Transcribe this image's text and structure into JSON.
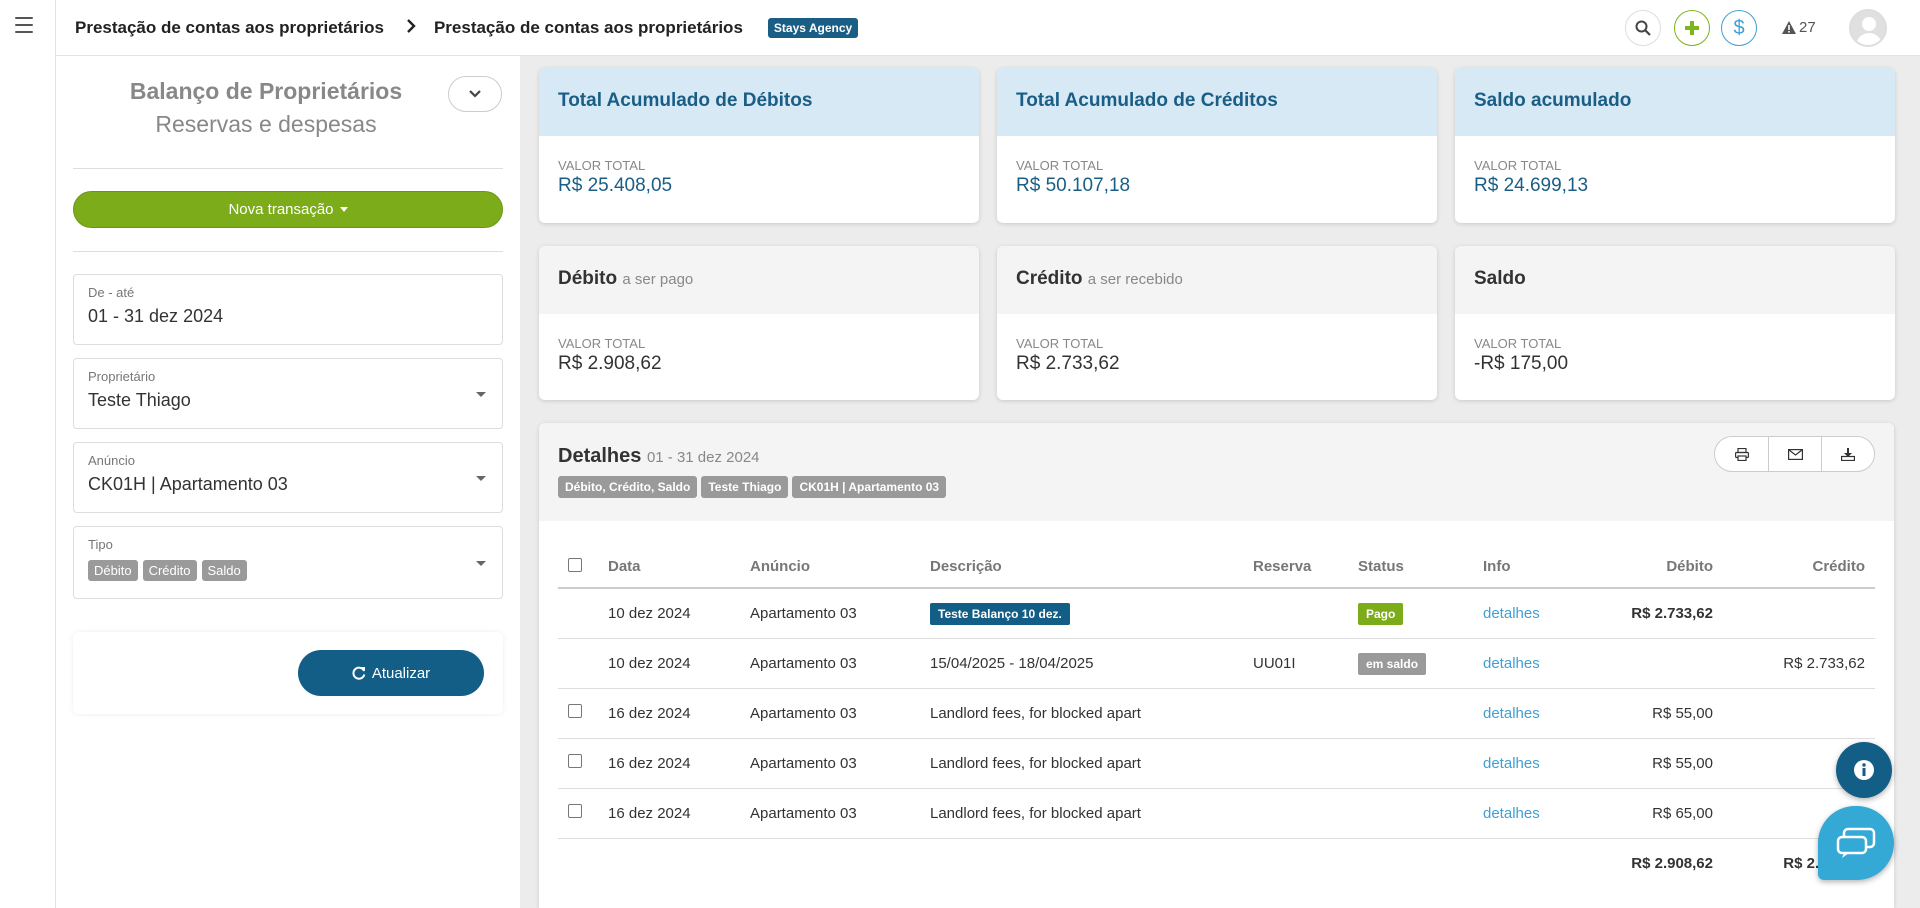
{
  "topbar": {
    "breadcrumb_1": "Prestação de contas aos proprietários",
    "breadcrumb_2": "Prestação de contas aos proprietários",
    "agency_badge": "Stays Agency",
    "alert_count": "27"
  },
  "sidebar": {
    "title": "Balanço de Proprietários",
    "subtitle": "Reservas e despesas",
    "new_transaction_label": "Nova transação",
    "date_range": {
      "label": "De - até",
      "value": "01 - 31 dez 2024"
    },
    "owner": {
      "label": "Proprietário",
      "value": "Teste Thiago"
    },
    "listing": {
      "label": "Anúncio",
      "value": "CK01H | Apartamento 03"
    },
    "type": {
      "label": "Tipo",
      "tags": [
        "Débito",
        "Crédito",
        "Saldo"
      ]
    },
    "refresh_label": "Atualizar"
  },
  "cards": {
    "debits_total": {
      "title": "Total Acumulado de Débitos",
      "label": "VALOR TOTAL",
      "value": "R$ 25.408,05"
    },
    "credits_total": {
      "title": "Total Acumulado de Créditos",
      "label": "VALOR TOTAL",
      "value": "R$ 50.107,18"
    },
    "balance_total": {
      "title": "Saldo acumulado",
      "label": "VALOR TOTAL",
      "value": "R$ 24.699,13"
    },
    "debit": {
      "title": "Débito",
      "subtitle": "a ser pago",
      "label": "VALOR TOTAL",
      "value": "R$ 2.908,62"
    },
    "credit": {
      "title": "Crédito",
      "subtitle": "a ser recebido",
      "label": "VALOR TOTAL",
      "value": "R$ 2.733,62"
    },
    "balance": {
      "title": "Saldo",
      "label": "VALOR TOTAL",
      "value": "-R$ 175,00"
    }
  },
  "details": {
    "title": "Detalhes",
    "range": "01 - 31 dez 2024",
    "filter_tags": [
      "Débito, Crédito, Saldo",
      "Teste Thiago",
      "CK01H | Apartamento 03"
    ],
    "columns": [
      "Data",
      "Anúncio",
      "Descrição",
      "Reserva",
      "Status",
      "Info",
      "Débito",
      "Crédito"
    ],
    "rows": [
      {
        "date": "10 dez 2024",
        "listing": "Apartamento 03",
        "description": "Teste Balanço 10 dez.",
        "reservation": "",
        "status": "Pago",
        "info": "detalhes",
        "debit": "R$ 2.733,62",
        "credit": ""
      },
      {
        "date": "10 dez 2024",
        "listing": "Apartamento 03",
        "description": "15/04/2025 - 18/04/2025",
        "reservation": "UU01I",
        "status": "em saldo",
        "info": "detalhes",
        "debit": "",
        "credit": "R$ 2.733,62"
      },
      {
        "date": "16 dez 2024",
        "listing": "Apartamento 03",
        "description": "Landlord fees, for blocked apart",
        "reservation": "",
        "status": "",
        "info": "detalhes",
        "debit": "R$ 55,00",
        "credit": ""
      },
      {
        "date": "16 dez 2024",
        "listing": "Apartamento 03",
        "description": "Landlord fees, for blocked apart",
        "reservation": "",
        "status": "",
        "info": "detalhes",
        "debit": "R$ 55,00",
        "credit": ""
      },
      {
        "date": "16 dez 2024",
        "listing": "Apartamento 03",
        "description": "Landlord fees, for blocked apart",
        "reservation": "",
        "status": "",
        "info": "detalhes",
        "debit": "R$ 65,00",
        "credit": ""
      }
    ],
    "totals": {
      "debit": "R$ 2.908,62",
      "credit": "R$ 2.733,62"
    }
  },
  "colors": {
    "primary": "#135e86",
    "accent_green": "#7cac1a",
    "link_blue": "#3f9fd6",
    "card_header_blue": "#d7e9f4"
  }
}
